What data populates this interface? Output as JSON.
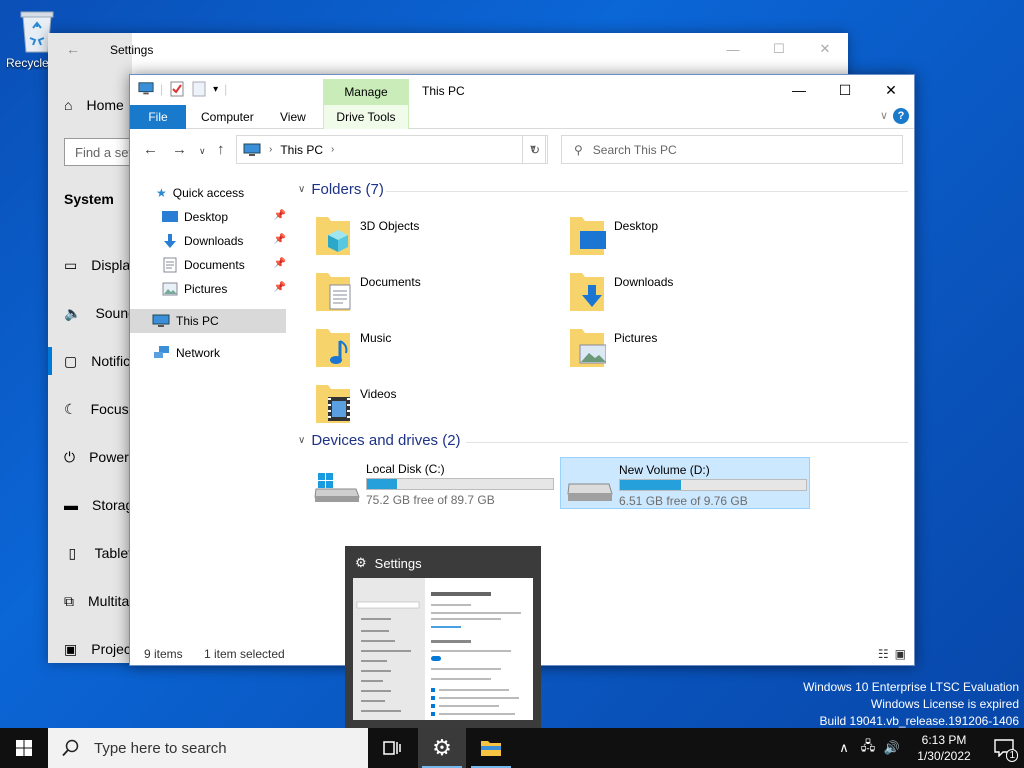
{
  "desktop": {
    "recycle_bin_label": "Recycle Bin"
  },
  "settings_window": {
    "title": "Settings",
    "home": "Home",
    "find_placeholder": "Find a setting",
    "section": "System",
    "nav": [
      "Display",
      "Sound",
      "Notifications & actions",
      "Focus assist",
      "Power & sleep",
      "Storage",
      "Tablet",
      "Multitasking",
      "Projecting to this PC"
    ]
  },
  "explorer": {
    "title": "This PC",
    "manage_tab": "Manage",
    "ribbon": {
      "file": "File",
      "computer": "Computer",
      "view": "View",
      "drive_tools": "Drive Tools",
      "help": "?"
    },
    "address": "This PC",
    "search_placeholder": "Search This PC",
    "nav_pane": {
      "quick_access": "Quick access",
      "pinned": [
        "Desktop",
        "Downloads",
        "Documents",
        "Pictures"
      ],
      "this_pc": "This PC",
      "network": "Network"
    },
    "folders_header": "Folders (7)",
    "folders": [
      "3D Objects",
      "Desktop",
      "Documents",
      "Downloads",
      "Music",
      "Pictures",
      "Videos"
    ],
    "devices_header": "Devices and drives (2)",
    "drives": [
      {
        "name": "Local Disk (C:)",
        "free": "75.2 GB free of 89.7 GB",
        "used_fraction": 0.16
      },
      {
        "name": "New Volume (D:)",
        "free": "6.51 GB free of 9.76 GB",
        "used_fraction": 0.33
      }
    ],
    "status": {
      "items": "9 items",
      "selected": "1 item selected"
    }
  },
  "thumbnail": {
    "title": "Settings"
  },
  "watermark": {
    "line1": "Windows 10 Enterprise LTSC Evaluation",
    "line2": "Windows License is expired",
    "line3": "Build 19041.vb_release.191206-1406"
  },
  "taskbar": {
    "search_placeholder": "Type here to search",
    "time": "6:13 PM",
    "date": "1/30/2022",
    "notification_count": "1"
  },
  "colors": {
    "accent": "#0078d7",
    "file_tab": "#1979ca",
    "drive_bar": "#26a0da",
    "manage_tab": "#c9ecb8"
  }
}
